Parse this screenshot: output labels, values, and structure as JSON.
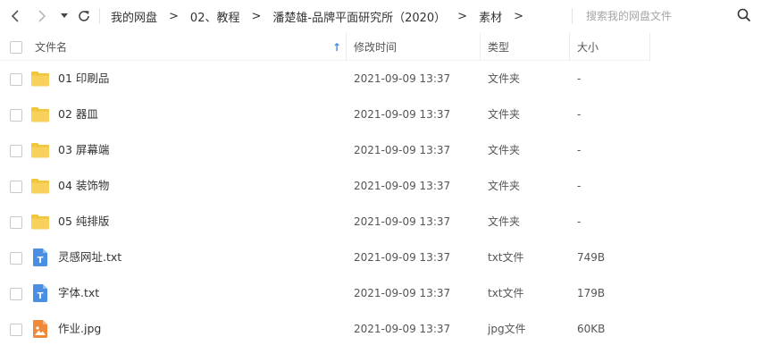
{
  "toolbar": {
    "back_icon": "chevron-left-icon",
    "forward_icon": "chevron-right-icon",
    "history_icon": "caret-down-icon",
    "refresh_icon": "refresh-icon"
  },
  "breadcrumb": {
    "items": [
      "我的网盘",
      "02、教程",
      "潘楚雄-品牌平面研究所（2020）",
      "素材"
    ],
    "separator": ">"
  },
  "search": {
    "placeholder": "搜索我的网盘文件",
    "value": ""
  },
  "columns": {
    "name": "文件名",
    "modified": "修改时间",
    "type": "类型",
    "size": "大小",
    "sort_indicator": "↑"
  },
  "files": [
    {
      "name": "01 印刷品",
      "modified": "2021-09-09 13:37",
      "type": "文件夹",
      "size": "-",
      "icon": "folder-icon"
    },
    {
      "name": "02 器皿",
      "modified": "2021-09-09 13:37",
      "type": "文件夹",
      "size": "-",
      "icon": "folder-icon"
    },
    {
      "name": "03 屏幕端",
      "modified": "2021-09-09 13:37",
      "type": "文件夹",
      "size": "-",
      "icon": "folder-icon"
    },
    {
      "name": "04 装饰物",
      "modified": "2021-09-09 13:37",
      "type": "文件夹",
      "size": "-",
      "icon": "folder-icon"
    },
    {
      "name": "05 纯排版",
      "modified": "2021-09-09 13:37",
      "type": "文件夹",
      "size": "-",
      "icon": "folder-icon"
    },
    {
      "name": "灵感网址.txt",
      "modified": "2021-09-09 13:37",
      "type": "txt文件",
      "size": "749B",
      "icon": "txt-file-icon"
    },
    {
      "name": "字体.txt",
      "modified": "2021-09-09 13:37",
      "type": "txt文件",
      "size": "179B",
      "icon": "txt-file-icon"
    },
    {
      "name": "作业.jpg",
      "modified": "2021-09-09 13:37",
      "type": "jpg文件",
      "size": "60KB",
      "icon": "image-file-icon"
    }
  ],
  "colors": {
    "folder": "#f7d15c",
    "folder_tab": "#f3c53c",
    "txt": "#4a90e2",
    "jpg": "#f0883a",
    "sort_arrow": "#3a8ee6"
  }
}
